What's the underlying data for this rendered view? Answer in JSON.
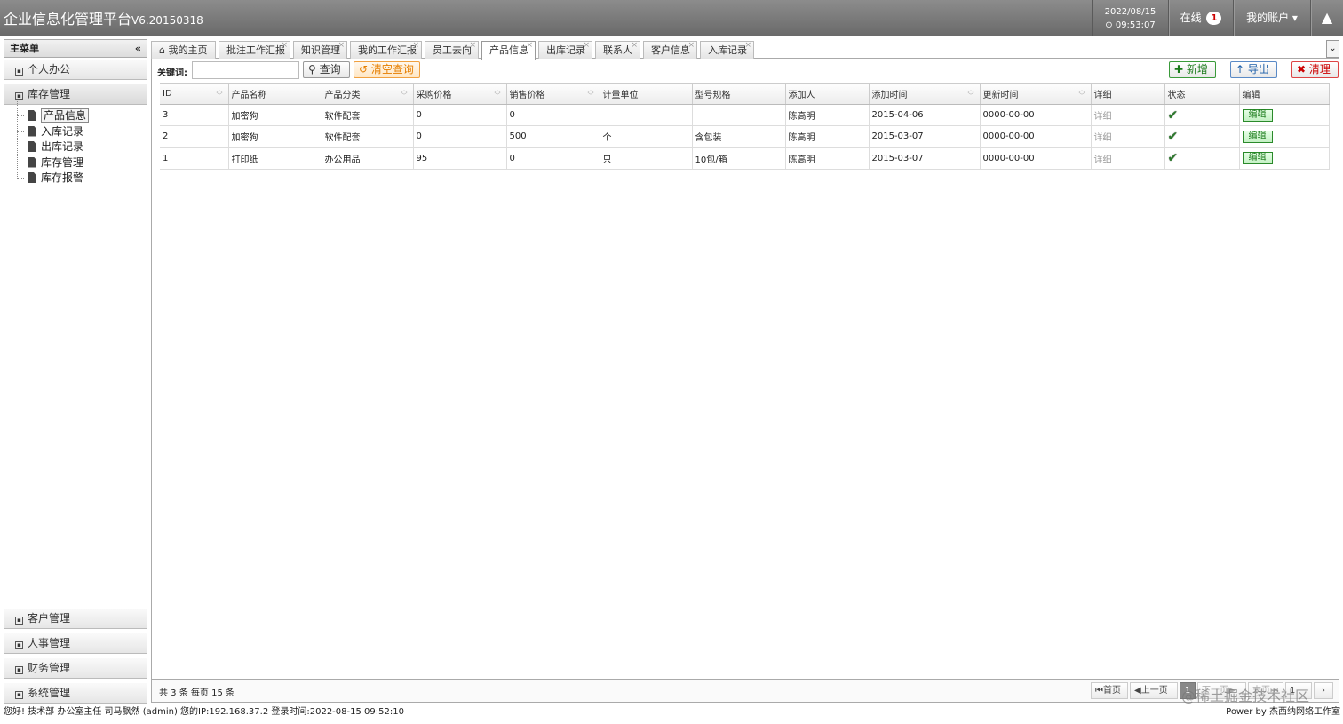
{
  "app": {
    "title": "企业信息化管理平台",
    "version": "V6.20150318",
    "date": "2022/08/15",
    "time": "09:53:07",
    "online_label": "在线",
    "online_count": "1",
    "account_label": "我的账户"
  },
  "sidebar": {
    "title": "主菜单",
    "collapse_icon": "«",
    "sections": {
      "personal": "个人办公",
      "inventory": "库存管理",
      "customer": "客户管理",
      "hr": "人事管理",
      "finance": "财务管理",
      "system": "系统管理"
    },
    "tree": [
      "产品信息",
      "入库记录",
      "出库记录",
      "库存管理",
      "库存报警"
    ]
  },
  "tabs": [
    "我的主页",
    "批注工作汇报",
    "知识管理",
    "我的工作汇报",
    "员工去向",
    "产品信息",
    "出库记录",
    "联系人",
    "客户信息",
    "入库记录"
  ],
  "toolbar": {
    "keyword_label": "关键词:",
    "keyword_value": "",
    "search_label": "查询",
    "clear_query_label": "清空查询",
    "add_label": "新增",
    "export_label": "导出",
    "clean_label": "清理"
  },
  "table": {
    "columns": [
      "ID",
      "产品名称",
      "产品分类",
      "采购价格",
      "销售价格",
      "计量单位",
      "型号规格",
      "添加人",
      "添加时间",
      "更新时间",
      "详细",
      "状态",
      "编辑"
    ],
    "rows": [
      {
        "id": "3",
        "name": "加密狗",
        "category": "软件配套",
        "purchase": "0",
        "sale": "0",
        "unit": "",
        "spec": "",
        "added_by": "陈高明",
        "added_at": "2015-04-06",
        "updated_at": "0000-00-00",
        "detail": "详细",
        "edit": "编辑"
      },
      {
        "id": "2",
        "name": "加密狗",
        "category": "软件配套",
        "purchase": "0",
        "sale": "500",
        "unit": "个",
        "spec": "含包装",
        "added_by": "陈高明",
        "added_at": "2015-03-07",
        "updated_at": "0000-00-00",
        "detail": "详细",
        "edit": "编辑"
      },
      {
        "id": "1",
        "name": "打印纸",
        "category": "办公用品",
        "purchase": "95",
        "sale": "0",
        "unit": "只",
        "spec": "10包/箱",
        "added_by": "陈高明",
        "added_at": "2015-03-07",
        "updated_at": "0000-00-00",
        "detail": "详细",
        "edit": "编辑"
      }
    ]
  },
  "pager": {
    "info": "共 3 条 每页 15 条",
    "first": "首页",
    "prev": "上一页",
    "current": "1",
    "next": "下一页",
    "last": "末页",
    "go": "1"
  },
  "watermark": "@稀土掘金技术社区",
  "status": {
    "left": "您好! 技术部 办公室主任 司马飘然 (admin) 您的IP:192.168.37.2 登录时间:2022-08-15 09:52:10",
    "right": "Power by 杰西纳网络工作室"
  }
}
